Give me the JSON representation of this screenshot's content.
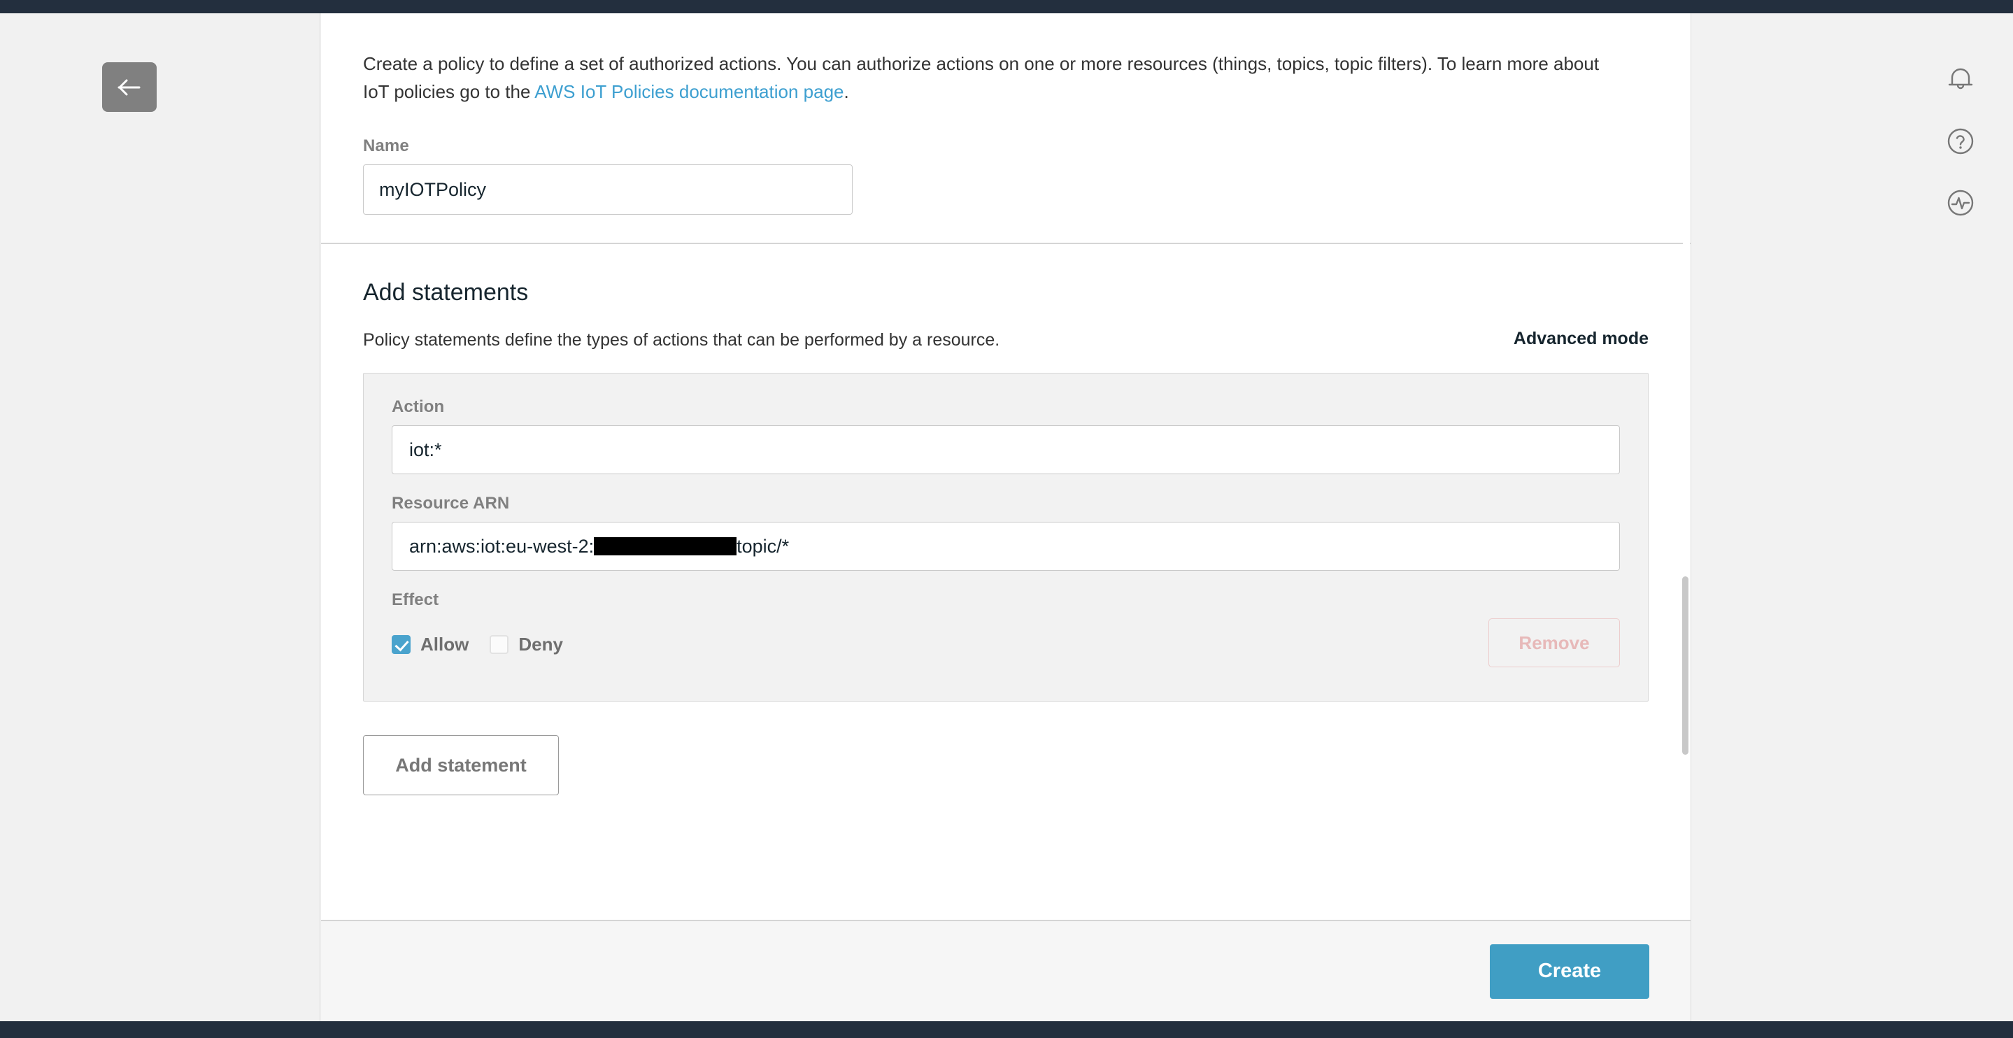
{
  "chrome": {
    "back_button_icon": "arrow-left-icon",
    "right_rail_icons": [
      "bell-icon",
      "help-circle-icon",
      "health-activity-icon"
    ]
  },
  "intro": {
    "text_before_link": "Create a policy to define a set of authorized actions. You can authorize actions on one or more resources (things, topics, topic filters). To learn more about IoT policies go to the ",
    "link_text": "AWS IoT Policies documentation page",
    "text_after_link": "."
  },
  "name_field": {
    "label": "Name",
    "value": "myIOTPolicy",
    "placeholder": ""
  },
  "statements": {
    "title": "Add statements",
    "subtitle": "Policy statements define the types of actions that can be performed by a resource.",
    "advanced_mode_label": "Advanced mode",
    "items": [
      {
        "action_label": "Action",
        "action_value": "iot:*",
        "resource_label": "Resource ARN",
        "resource_value_prefix": "arn:aws:iot:eu-west-2:",
        "resource_value_redacted": "[redacted account id]",
        "resource_value_suffix": "topic/*",
        "effect_label": "Effect",
        "allow_label": "Allow",
        "allow_checked": true,
        "deny_label": "Deny",
        "deny_checked": false,
        "remove_label": "Remove",
        "remove_disabled": true
      }
    ],
    "add_statement_label": "Add statement"
  },
  "footer": {
    "create_label": "Create"
  },
  "colors": {
    "accent_blue": "#409ec4",
    "link_blue": "#3d9fd0",
    "checkbox_blue": "#4aa3cd",
    "console_navy": "#232f3e",
    "panel_gray": "#f2f2f2"
  }
}
